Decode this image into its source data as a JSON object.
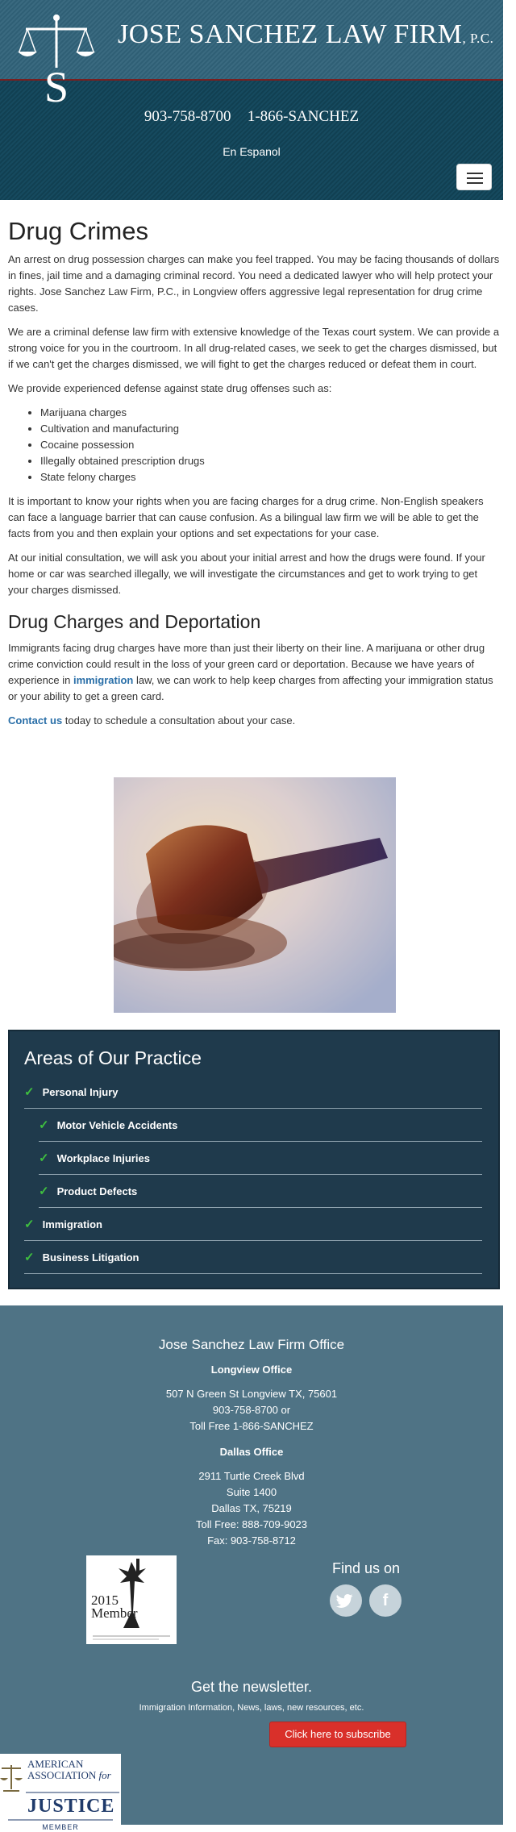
{
  "header": {
    "firm_name": "Jose Sanchez Law Firm",
    "firm_suffix": "P.C.",
    "phone_1": "903-758-8700",
    "phone_2": "1-866-SANCHEZ",
    "language_link": "En Espanol",
    "menu_icon": "hamburger-menu-icon"
  },
  "main": {
    "title": "Drug Crimes",
    "p1": "An arrest on drug possession charges can make you feel trapped. You may be facing thousands of dollars in fines, jail time and a damaging criminal record. You need a dedicated lawyer who will help protect your rights. Jose Sanchez Law Firm, P.C., in Longview offers aggressive legal representation for drug crime cases.",
    "p2": "We are a criminal defense law firm with extensive knowledge of the Texas court system. We can provide a strong voice for you in the courtroom. In all drug-related cases, we seek to get the charges dismissed, but if we can't get the charges dismissed, we will fight to get the charges reduced or defeat them in court.",
    "p3": "We provide experienced defense against state drug offenses such as:",
    "offenses": [
      "Marijuana charges",
      "Cultivation and manufacturing",
      "Cocaine possession",
      "Illegally obtained prescription drugs",
      "State felony charges"
    ],
    "p4": "It is important to know your rights when you are facing charges for a drug crime. Non-English speakers can face a language barrier that can cause confusion. As a bilingual law firm we will be able to get the facts from you and then explain your options and set expectations for your case.",
    "p5": "At our initial consultation, we will ask you about your initial arrest and how the drugs were found. If your home or car was searched illegally, we will investigate the circumstances and get to work trying to get your charges dismissed.",
    "subtitle": "Drug Charges and Deportation",
    "p6_before": "Immigrants facing drug charges have more than just their liberty on their line. A marijuana or other drug crime conviction could result in the loss of your green card or deportation. Because we have years of experience in ",
    "p6_link": "immigration",
    "p6_after": " law, we can work to help keep charges from affecting your immigration status or your ability to get a green card.",
    "contact_link": "Contact us",
    "contact_after": " today to schedule a consultation about your case."
  },
  "practice": {
    "title": "Areas of Our Practice",
    "items": [
      "Personal Injury",
      "Motor Vehicle Accidents",
      "Workplace Injuries",
      "Product Defects",
      "Immigration",
      "Business Litigation"
    ]
  },
  "footer": {
    "title": "Jose Sanchez Law Firm Office",
    "longview_heading": "Longview Office",
    "longview_address": "507 N Green St Longview TX, 75601",
    "longview_phone": "903-758-8700 or",
    "longview_tollfree": "Toll Free 1-866-SANCHEZ",
    "dallas_heading": "Dallas Office",
    "dallas_street": "2911 Turtle Creek Blvd",
    "dallas_suite": "Suite 1400",
    "dallas_city": "Dallas TX, 75219",
    "dallas_tollfree": "Toll Free: 888-709-9023",
    "dallas_fax": "Fax: 903-758-8712",
    "badge_year": "2015",
    "badge_label": "Member",
    "find_us": "Find us on",
    "newsletter_title": "Get the newsletter.",
    "newsletter_sub": "Immigration Information, News, laws, new resources, etc.",
    "subscribe_label": "Click here to subscribe",
    "aaj_line1": "AMERICAN",
    "aaj_line2": "ASSOCIATION",
    "aaj_for": "for",
    "aaj_line3": "JUSTICE",
    "aaj_member": "MEMBER"
  }
}
